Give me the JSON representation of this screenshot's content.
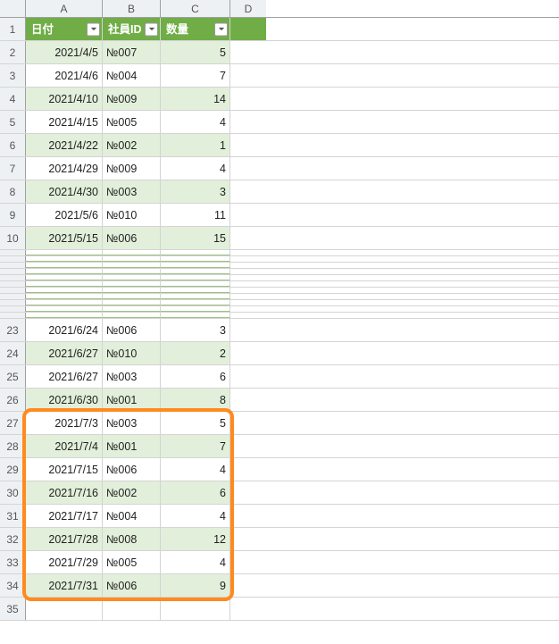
{
  "columns": {
    "A": "A",
    "B": "B",
    "C": "C",
    "D": "D"
  },
  "headers": {
    "date": "日付",
    "employee_id": "社員ID",
    "quantity": "数量"
  },
  "rows_top": [
    {
      "n": 2,
      "date": "2021/4/5",
      "emp": "№007",
      "qty": 5,
      "band": "even"
    },
    {
      "n": 3,
      "date": "2021/4/6",
      "emp": "№004",
      "qty": 7,
      "band": "odd"
    },
    {
      "n": 4,
      "date": "2021/4/10",
      "emp": "№009",
      "qty": 14,
      "band": "even"
    },
    {
      "n": 5,
      "date": "2021/4/15",
      "emp": "№005",
      "qty": 4,
      "band": "odd"
    },
    {
      "n": 6,
      "date": "2021/4/22",
      "emp": "№002",
      "qty": 1,
      "band": "even"
    },
    {
      "n": 7,
      "date": "2021/4/29",
      "emp": "№009",
      "qty": 4,
      "band": "odd"
    },
    {
      "n": 8,
      "date": "2021/4/30",
      "emp": "№003",
      "qty": 3,
      "band": "even"
    },
    {
      "n": 9,
      "date": "2021/5/6",
      "emp": "№010",
      "qty": 11,
      "band": "odd"
    },
    {
      "n": 10,
      "date": "2021/5/15",
      "emp": "№006",
      "qty": 15,
      "band": "even"
    }
  ],
  "collapsed_gap_rows": 11,
  "rows_mid": [
    {
      "n": 23,
      "date": "2021/6/24",
      "emp": "№006",
      "qty": 3,
      "band": "odd"
    },
    {
      "n": 24,
      "date": "2021/6/27",
      "emp": "№010",
      "qty": 2,
      "band": "even"
    },
    {
      "n": 25,
      "date": "2021/6/27",
      "emp": "№003",
      "qty": 6,
      "band": "odd"
    },
    {
      "n": 26,
      "date": "2021/6/30",
      "emp": "№001",
      "qty": 8,
      "band": "even"
    }
  ],
  "rows_highlight": [
    {
      "n": 27,
      "date": "2021/7/3",
      "emp": "№003",
      "qty": 5,
      "band": "odd"
    },
    {
      "n": 28,
      "date": "2021/7/4",
      "emp": "№001",
      "qty": 7,
      "band": "even"
    },
    {
      "n": 29,
      "date": "2021/7/15",
      "emp": "№006",
      "qty": 4,
      "band": "odd"
    },
    {
      "n": 30,
      "date": "2021/7/16",
      "emp": "№002",
      "qty": 6,
      "band": "even"
    },
    {
      "n": 31,
      "date": "2021/7/17",
      "emp": "№004",
      "qty": 4,
      "band": "odd"
    },
    {
      "n": 32,
      "date": "2021/7/28",
      "emp": "№008",
      "qty": 12,
      "band": "even"
    },
    {
      "n": 33,
      "date": "2021/7/29",
      "emp": "№005",
      "qty": 4,
      "band": "odd"
    },
    {
      "n": 34,
      "date": "2021/7/31",
      "emp": "№006",
      "qty": 9,
      "band": "even"
    }
  ],
  "empty_tail_row": 35
}
